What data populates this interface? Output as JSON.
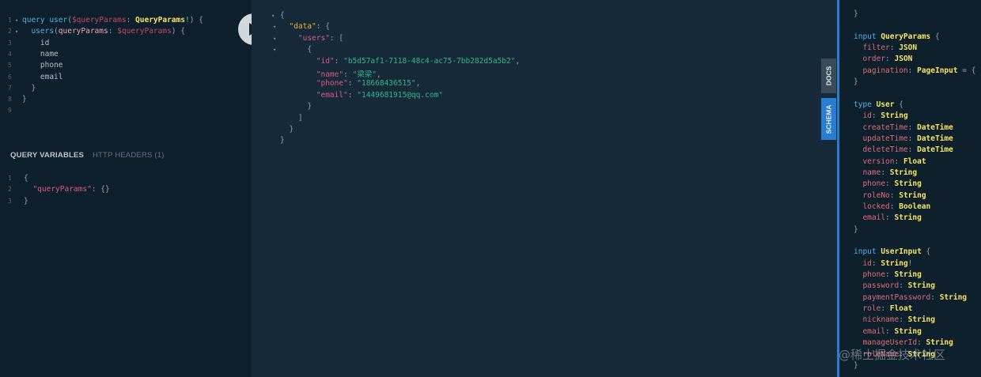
{
  "query": {
    "line_numbers": [
      "1",
      "2",
      "3",
      "4",
      "5",
      "6",
      "7",
      "8",
      "9"
    ],
    "lines": [
      [
        {
          "t": "query ",
          "c": "kw"
        },
        {
          "t": "user",
          "c": "fn"
        },
        {
          "t": "(",
          "c": "punc"
        },
        {
          "t": "$queryParams",
          "c": "var"
        },
        {
          "t": ": ",
          "c": "punc"
        },
        {
          "t": "QueryParams",
          "c": "type"
        },
        {
          "t": "!) {",
          "c": "punc"
        }
      ],
      [
        {
          "t": "  users",
          "c": "fn"
        },
        {
          "t": "(",
          "c": "punc"
        },
        {
          "t": "queryParams",
          "c": "arg"
        },
        {
          "t": ": ",
          "c": "punc"
        },
        {
          "t": "$queryParams",
          "c": "var"
        },
        {
          "t": ") {",
          "c": "punc"
        }
      ],
      [
        {
          "t": "    id",
          "c": "field"
        }
      ],
      [
        {
          "t": "    name",
          "c": "field"
        }
      ],
      [
        {
          "t": "    phone",
          "c": "field"
        }
      ],
      [
        {
          "t": "    email",
          "c": "field"
        }
      ],
      [
        {
          "t": "  }",
          "c": "punc"
        }
      ],
      [
        {
          "t": "}",
          "c": "punc"
        }
      ],
      []
    ]
  },
  "variables_panel": {
    "tab_active": "QUERY VARIABLES",
    "tab_other": "HTTP HEADERS (1)",
    "line_numbers": [
      "1",
      "2",
      "3"
    ],
    "lines": [
      [
        {
          "t": "{",
          "c": "punc"
        }
      ],
      [
        {
          "t": "  \"queryParams\"",
          "c": "key"
        },
        {
          "t": ": {}",
          "c": "punc"
        }
      ],
      [
        {
          "t": "}",
          "c": "punc"
        }
      ]
    ]
  },
  "result": {
    "lines": [
      [
        {
          "t": "{",
          "c": "jsonpunc"
        }
      ],
      [
        {
          "t": "  \"data\"",
          "c": "key2"
        },
        {
          "t": ": {",
          "c": "jsonpunc"
        }
      ],
      [
        {
          "t": "    \"users\"",
          "c": "key"
        },
        {
          "t": ": [",
          "c": "jsonpunc"
        }
      ],
      [
        {
          "t": "      {",
          "c": "jsonpunc"
        }
      ],
      [
        {
          "t": "        \"id\"",
          "c": "key"
        },
        {
          "t": ": ",
          "c": "jsonpunc"
        },
        {
          "t": "\"b5d57af1-7118-48c4-ac75-7bb282d5a5b2\"",
          "c": "str"
        },
        {
          "t": ",",
          "c": "jsonpunc"
        }
      ],
      [
        {
          "t": "        \"name\"",
          "c": "key"
        },
        {
          "t": ": ",
          "c": "jsonpunc"
        },
        {
          "t": "\"梁梁\"",
          "c": "str"
        },
        {
          "t": ",",
          "c": "jsonpunc"
        }
      ],
      [
        {
          "t": "        \"phone\"",
          "c": "key"
        },
        {
          "t": ": ",
          "c": "jsonpunc"
        },
        {
          "t": "\"18668436515\"",
          "c": "str"
        },
        {
          "t": ",",
          "c": "jsonpunc"
        }
      ],
      [
        {
          "t": "        \"email\"",
          "c": "key"
        },
        {
          "t": ": ",
          "c": "jsonpunc"
        },
        {
          "t": "\"1449681915@qq.com\"",
          "c": "str"
        }
      ],
      [
        {
          "t": "      }",
          "c": "jsonpunc"
        }
      ],
      [
        {
          "t": "    ]",
          "c": "jsonpunc"
        }
      ],
      [
        {
          "t": "  }",
          "c": "jsonpunc"
        }
      ],
      [
        {
          "t": "}",
          "c": "jsonpunc"
        }
      ]
    ]
  },
  "side_tabs": {
    "docs": "DOCS",
    "schema": "SCHEMA"
  },
  "schema": {
    "lines": [
      [
        {
          "t": "}",
          "c": "punc"
        }
      ],
      [],
      [
        {
          "t": "input ",
          "c": "kw"
        },
        {
          "t": "QueryParams",
          "c": "type"
        },
        {
          "t": " {",
          "c": "punc"
        }
      ],
      [
        {
          "t": "  filter",
          "c": "schema-field"
        },
        {
          "t": ": ",
          "c": "punc"
        },
        {
          "t": "JSON",
          "c": "type"
        }
      ],
      [
        {
          "t": "  order",
          "c": "schema-field"
        },
        {
          "t": ": ",
          "c": "punc"
        },
        {
          "t": "JSON",
          "c": "type"
        }
      ],
      [
        {
          "t": "  pagination",
          "c": "schema-field"
        },
        {
          "t": ": ",
          "c": "punc"
        },
        {
          "t": "PageInput",
          "c": "type"
        },
        {
          "t": " = { p",
          "c": "punc"
        }
      ],
      [
        {
          "t": "}",
          "c": "punc"
        }
      ],
      [],
      [
        {
          "t": "type ",
          "c": "kw"
        },
        {
          "t": "User",
          "c": "type"
        },
        {
          "t": " {",
          "c": "punc"
        }
      ],
      [
        {
          "t": "  id",
          "c": "schema-field"
        },
        {
          "t": ": ",
          "c": "punc"
        },
        {
          "t": "String",
          "c": "type"
        }
      ],
      [
        {
          "t": "  createTime",
          "c": "schema-field"
        },
        {
          "t": ": ",
          "c": "punc"
        },
        {
          "t": "DateTime",
          "c": "type"
        }
      ],
      [
        {
          "t": "  updateTime",
          "c": "schema-field"
        },
        {
          "t": ": ",
          "c": "punc"
        },
        {
          "t": "DateTime",
          "c": "type"
        }
      ],
      [
        {
          "t": "  deleteTime",
          "c": "schema-field"
        },
        {
          "t": ": ",
          "c": "punc"
        },
        {
          "t": "DateTime",
          "c": "type"
        }
      ],
      [
        {
          "t": "  version",
          "c": "schema-field"
        },
        {
          "t": ": ",
          "c": "punc"
        },
        {
          "t": "Float",
          "c": "type"
        }
      ],
      [
        {
          "t": "  name",
          "c": "schema-field"
        },
        {
          "t": ": ",
          "c": "punc"
        },
        {
          "t": "String",
          "c": "type"
        }
      ],
      [
        {
          "t": "  phone",
          "c": "schema-field"
        },
        {
          "t": ": ",
          "c": "punc"
        },
        {
          "t": "String",
          "c": "type"
        }
      ],
      [
        {
          "t": "  roleNo",
          "c": "schema-field"
        },
        {
          "t": ": ",
          "c": "punc"
        },
        {
          "t": "String",
          "c": "type"
        }
      ],
      [
        {
          "t": "  locked",
          "c": "schema-field"
        },
        {
          "t": ": ",
          "c": "punc"
        },
        {
          "t": "Boolean",
          "c": "type"
        }
      ],
      [
        {
          "t": "  email",
          "c": "schema-field"
        },
        {
          "t": ": ",
          "c": "punc"
        },
        {
          "t": "String",
          "c": "type"
        }
      ],
      [
        {
          "t": "}",
          "c": "punc"
        }
      ],
      [],
      [
        {
          "t": "input ",
          "c": "kw"
        },
        {
          "t": "UserInput",
          "c": "type"
        },
        {
          "t": " {",
          "c": "punc"
        }
      ],
      [
        {
          "t": "  id",
          "c": "schema-field"
        },
        {
          "t": ": ",
          "c": "punc"
        },
        {
          "t": "String",
          "c": "type"
        },
        {
          "t": "!",
          "c": "punc"
        }
      ],
      [
        {
          "t": "  phone",
          "c": "schema-field"
        },
        {
          "t": ": ",
          "c": "punc"
        },
        {
          "t": "String",
          "c": "type"
        }
      ],
      [
        {
          "t": "  password",
          "c": "schema-field"
        },
        {
          "t": ": ",
          "c": "punc"
        },
        {
          "t": "String",
          "c": "type"
        }
      ],
      [
        {
          "t": "  paymentPassword",
          "c": "schema-field"
        },
        {
          "t": ": ",
          "c": "punc"
        },
        {
          "t": "String",
          "c": "type"
        }
      ],
      [
        {
          "t": "  role",
          "c": "schema-field"
        },
        {
          "t": ": ",
          "c": "punc"
        },
        {
          "t": "Float",
          "c": "type"
        }
      ],
      [
        {
          "t": "  nickname",
          "c": "schema-field"
        },
        {
          "t": ": ",
          "c": "punc"
        },
        {
          "t": "String",
          "c": "type"
        }
      ],
      [
        {
          "t": "  email",
          "c": "schema-field"
        },
        {
          "t": ": ",
          "c": "punc"
        },
        {
          "t": "String",
          "c": "type"
        }
      ],
      [
        {
          "t": "  manageUserId",
          "c": "schema-field"
        },
        {
          "t": ": ",
          "c": "punc"
        },
        {
          "t": "String",
          "c": "type"
        }
      ],
      [
        {
          "t": "  roleName",
          "c": "schema-field"
        },
        {
          "t": ": ",
          "c": "punc"
        },
        {
          "t": "String",
          "c": "type"
        }
      ],
      [
        {
          "t": "}",
          "c": "punc"
        }
      ]
    ]
  },
  "watermark": "@稀土掘金技术社区",
  "colors": {
    "accent": "#2a7ed2",
    "background": "#172a3a",
    "editor_bg": "#0f202d"
  }
}
